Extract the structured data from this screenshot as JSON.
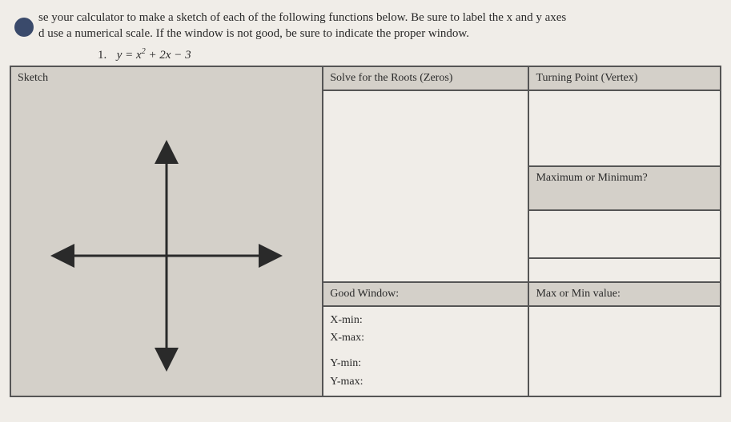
{
  "intro": {
    "line1_part1": "se your calculator to make a sketch of each of the following functions below. Be sure to label the x and y axes",
    "line2": "d use a numerical scale. If the window is not good, be sure to indicate the proper window."
  },
  "equation": {
    "number": "1.",
    "expr_prefix": "y = x",
    "expr_exp": "2",
    "expr_suffix": " + 2x − 3"
  },
  "table": {
    "sketch_header": "Sketch",
    "roots_header": "Solve for the Roots (Zeros)",
    "vertex_header": "Turning Point (Vertex)",
    "maxmin_header": "Maximum or Minimum?",
    "window_header": "Good Window:",
    "maxminval_header": "Max or Min value:",
    "xmin_label": "X-min:",
    "xmax_label": "X-max:",
    "ymin_label": "Y-min:",
    "ymax_label": "Y-max:"
  }
}
